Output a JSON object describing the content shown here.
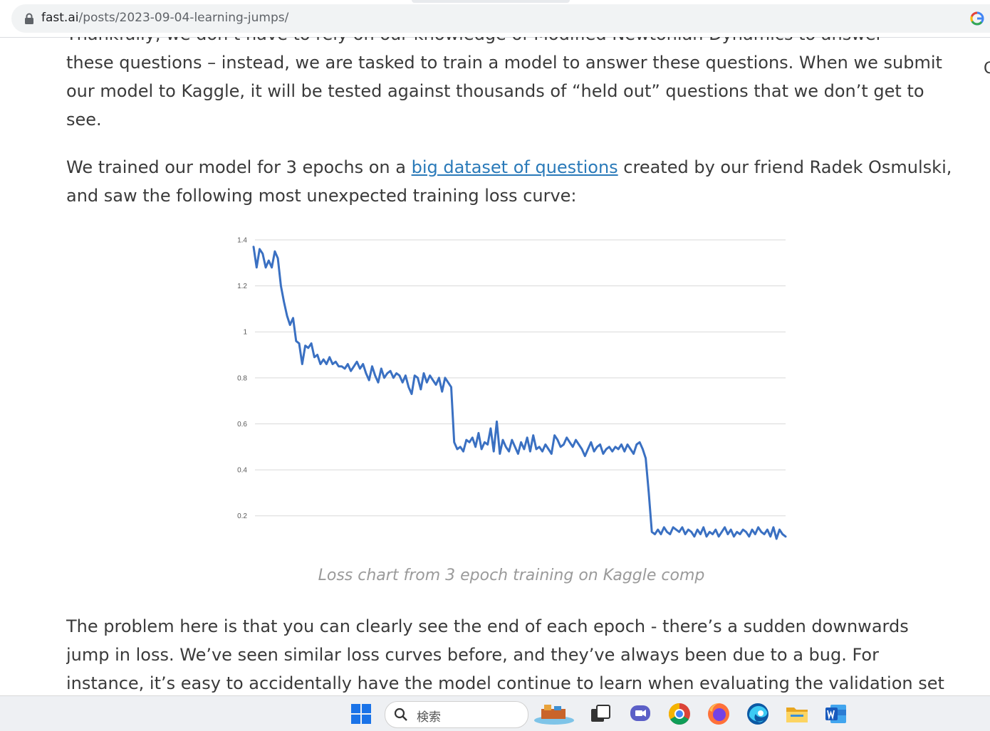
{
  "browser": {
    "url_host": "fast.ai",
    "url_path": "/posts/2023-09-04-learning-jumps/"
  },
  "article": {
    "cut_line": "Thankfully, we don’t have to rely on our knowledge of Modified Newtonian Dynamics to answer",
    "para1": "these questions – instead, we are tasked to train a model to answer these questions. When we submit our model to Kaggle, it will be tested against thousands of “held out” questions that we don’t get to see.",
    "para2_before": "We trained our model for 3 epochs on a ",
    "para2_link": "big dataset of questions",
    "para2_after": " created by our friend Radek Osmulski, and saw the following most unexpected training loss curve:",
    "caption": "Loss chart from 3 epoch training on Kaggle comp",
    "para3": "The problem here is that you can clearly see the end of each epoch - there’s a sudden downwards jump in loss. We’ve seen similar loss curves before, and they’ve always been due to a bug. For instance, it’s easy to accidentally have the model continue to learn when evaluating the validation set",
    "edge_char": "C"
  },
  "taskbar": {
    "search_placeholder": "検索",
    "icons": [
      "windows-start-icon",
      "search-icon",
      "widgets-icon",
      "task-view-icon",
      "teams-chat-icon",
      "chrome-icon",
      "firefox-icon",
      "edge-icon",
      "file-explorer-icon",
      "word-icon"
    ]
  },
  "colors": {
    "link": "#2a7ab9",
    "series_line": "#3a70c2",
    "text": "#3a3a3a",
    "caption": "#9a9a9a",
    "gridline": "#d9d9d9"
  },
  "chart_data": {
    "type": "line",
    "title": "",
    "xlabel": "",
    "ylabel": "",
    "ylim": [
      0.1,
      1.4
    ],
    "yticks": [
      0.2,
      0.4,
      0.6,
      0.8,
      1,
      1.2,
      1.4
    ],
    "ytick_labels": [
      "0.2",
      "0.4",
      "0.6",
      "0.8",
      "1",
      "1.2",
      "1.4"
    ],
    "grid": true,
    "legend": "none",
    "series": [
      {
        "values": [
          1.37,
          1.28,
          1.36,
          1.34,
          1.28,
          1.31,
          1.28,
          1.35,
          1.32,
          1.2,
          1.13,
          1.07,
          1.03,
          1.06,
          0.96,
          0.95,
          0.86,
          0.94,
          0.93,
          0.95,
          0.89,
          0.9,
          0.86,
          0.88,
          0.86,
          0.89,
          0.86,
          0.87,
          0.85,
          0.85,
          0.84,
          0.86,
          0.83,
          0.85,
          0.87,
          0.84,
          0.86,
          0.82,
          0.79,
          0.85,
          0.81,
          0.78,
          0.84,
          0.8,
          0.82,
          0.83,
          0.8,
          0.82,
          0.81,
          0.78,
          0.81,
          0.76,
          0.73,
          0.81,
          0.8,
          0.75,
          0.82,
          0.78,
          0.81,
          0.79,
          0.77,
          0.8,
          0.74,
          0.8,
          0.78,
          0.76,
          0.52,
          0.49,
          0.5,
          0.48,
          0.53,
          0.52,
          0.54,
          0.5,
          0.56,
          0.49,
          0.52,
          0.51,
          0.58,
          0.48,
          0.61,
          0.47,
          0.53,
          0.5,
          0.48,
          0.53,
          0.5,
          0.47,
          0.52,
          0.49,
          0.54,
          0.48,
          0.55,
          0.49,
          0.5,
          0.48,
          0.51,
          0.49,
          0.47,
          0.55,
          0.53,
          0.5,
          0.51,
          0.54,
          0.52,
          0.5,
          0.53,
          0.51,
          0.49,
          0.46,
          0.49,
          0.52,
          0.48,
          0.5,
          0.51,
          0.47,
          0.49,
          0.5,
          0.48,
          0.5,
          0.49,
          0.51,
          0.48,
          0.51,
          0.49,
          0.47,
          0.51,
          0.52,
          0.49,
          0.45,
          0.3,
          0.13,
          0.12,
          0.14,
          0.12,
          0.15,
          0.13,
          0.12,
          0.15,
          0.14,
          0.13,
          0.15,
          0.12,
          0.14,
          0.13,
          0.11,
          0.14,
          0.12,
          0.15,
          0.11,
          0.13,
          0.12,
          0.14,
          0.11,
          0.13,
          0.15,
          0.12,
          0.14,
          0.11,
          0.13,
          0.12,
          0.14,
          0.13,
          0.11,
          0.14,
          0.12,
          0.15,
          0.13,
          0.12,
          0.14,
          0.11,
          0.15,
          0.1,
          0.14,
          0.12,
          0.11
        ]
      }
    ]
  }
}
